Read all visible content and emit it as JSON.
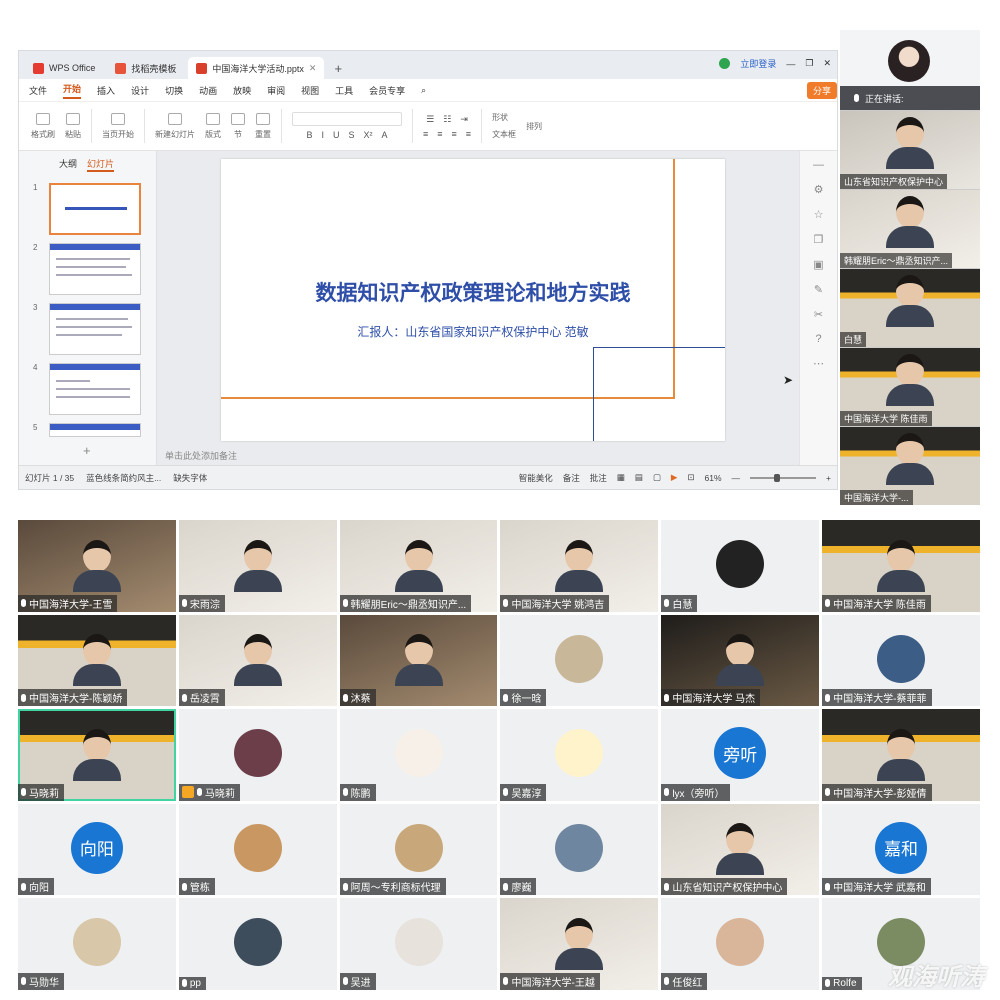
{
  "tabs": [
    {
      "label": "WPS Office"
    },
    {
      "label": "找稻壳模板"
    },
    {
      "label": "中国海洋大学活动.pptx"
    }
  ],
  "window": {
    "login": "立即登录",
    "share": "分享"
  },
  "menu": [
    "文件",
    "开始",
    "插入",
    "设计",
    "切换",
    "动画",
    "放映",
    "审阅",
    "视图",
    "工具",
    "会员专享"
  ],
  "ribbon": {
    "format_painter": "格式刷",
    "paste": "粘贴",
    "play_from": "当页开始",
    "new_slide": "新建幻灯片",
    "layout": "版式",
    "section": "节",
    "reset": "重置",
    "shape": "形状",
    "textbox": "文本框",
    "arrange": "排列"
  },
  "left_panel": {
    "tab_outline": "大纲",
    "tab_slides": "幻灯片",
    "slide_numbers": [
      "1",
      "2",
      "3",
      "4",
      "5"
    ]
  },
  "slide": {
    "title": "数据知识产权政策理论和地方实践",
    "subtitle": "汇报人：山东省国家知识产权保护中心  范敏",
    "note_hint": "单击此处添加备注"
  },
  "status": {
    "slide_count": "幻灯片 1 / 35",
    "theme": "蓝色线条简约风主...",
    "missing_font": "缺失字体",
    "smart_beautify": "智能美化",
    "notes": "备注",
    "comments": "批注",
    "zoom": "61%",
    "zoom_fraction": 0.4
  },
  "strip": {
    "speaking": "正在讲话:",
    "tiles": [
      {
        "name": "山东省知识产权保护中心"
      },
      {
        "name": "韩耀朋Eric～鼎丞知识产..."
      },
      {
        "name": "白慧"
      },
      {
        "name": "中国海洋大学 陈佳雨"
      },
      {
        "name": "中国海洋大学-..."
      }
    ]
  },
  "grid": [
    {
      "name": "中国海洋大学-王雪",
      "kind": "video"
    },
    {
      "name": "宋雨淙",
      "kind": "video-light"
    },
    {
      "name": "韩耀朋Eric～鼎丞知识产...",
      "kind": "video-light"
    },
    {
      "name": "中国海洋大学  姚鸿吉",
      "kind": "video-light"
    },
    {
      "name": "白慧",
      "kind": "avatar",
      "color": "#222222"
    },
    {
      "name": "中国海洋大学 陈佳雨",
      "kind": "video-orange"
    },
    {
      "name": "中国海洋大学-陈颖娇",
      "kind": "video-orange"
    },
    {
      "name": "岳凌霄",
      "kind": "video-light"
    },
    {
      "name": "沐蔡",
      "kind": "video"
    },
    {
      "name": "徐一晗",
      "kind": "avatar",
      "color": "#c9b79a"
    },
    {
      "name": "中国海洋大学 马杰",
      "kind": "video-dark"
    },
    {
      "name": "中国海洋大学-蔡菲菲",
      "kind": "avatar",
      "color": "#3c5d86"
    },
    {
      "name": "马晓莉",
      "kind": "video-orange",
      "selected": true
    },
    {
      "name": "马晓莉",
      "kind": "avatar",
      "color": "#6b3e4a",
      "host": true
    },
    {
      "name": "陈鹏",
      "kind": "avatar",
      "color": "#f6f0e8"
    },
    {
      "name": "吴嘉淳",
      "kind": "avatar",
      "color": "#fff3cc"
    },
    {
      "name": "lyx（旁听）",
      "kind": "text",
      "text": "旁听"
    },
    {
      "name": "中国海洋大学-彭娅倩",
      "kind": "video-orange"
    },
    {
      "name": "向阳",
      "kind": "text",
      "text": "向阳"
    },
    {
      "name": "管栋",
      "kind": "avatar",
      "color": "#c99761"
    },
    {
      "name": "阿周～专利商标代理",
      "kind": "avatar",
      "color": "#c8a77a"
    },
    {
      "name": "廖巍",
      "kind": "avatar",
      "color": "#6f86a0"
    },
    {
      "name": "山东省知识产权保护中心",
      "kind": "video-light"
    },
    {
      "name": "中国海洋大学 武嘉和",
      "kind": "text",
      "text": "嘉和"
    },
    {
      "name": "马勋华",
      "kind": "avatar",
      "color": "#d8c7a8"
    },
    {
      "name": "pp",
      "kind": "avatar",
      "color": "#3e4d5c"
    },
    {
      "name": "吴进",
      "kind": "avatar",
      "color": "#e7e2dc"
    },
    {
      "name": "中国海洋大学-王越",
      "kind": "video-light"
    },
    {
      "name": "任俊红",
      "kind": "avatar",
      "color": "#d9b59a"
    },
    {
      "name": "Rolfe",
      "kind": "avatar",
      "color": "#7c8c62"
    }
  ],
  "watermark": "观海听涛"
}
